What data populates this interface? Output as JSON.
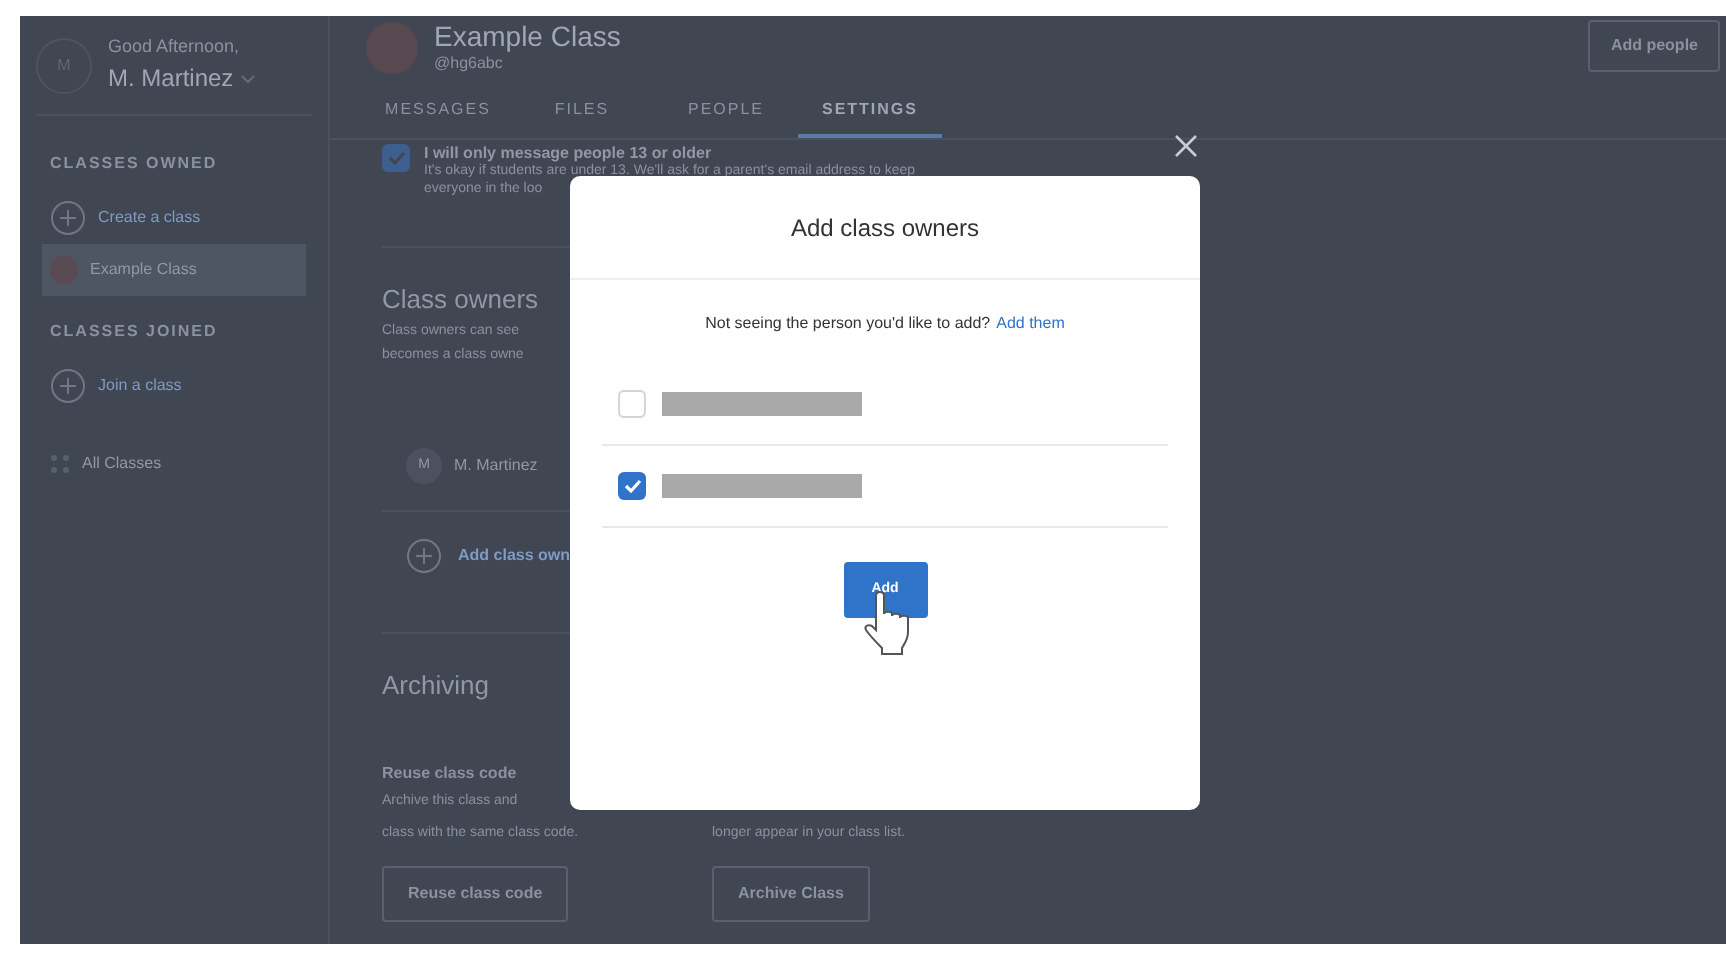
{
  "sidebar": {
    "avatar_initial": "M",
    "greeting": "Good Afternoon,",
    "user_name": "M. Martinez",
    "sections": [
      {
        "heading": "CLASSES OWNED",
        "items": [
          {
            "kind": "action",
            "label": "Create a class",
            "selected": false
          },
          {
            "kind": "class",
            "label": "Example Class",
            "selected": true
          }
        ]
      },
      {
        "heading": "CLASSES JOINED",
        "items": [
          {
            "kind": "action",
            "label": "Join a class",
            "selected": false
          }
        ]
      }
    ],
    "all_classes": "All Classes"
  },
  "header": {
    "class_name": "Example Class",
    "class_code": "@hg6abc",
    "tabs": [
      {
        "label": "MESSAGES",
        "selected": false
      },
      {
        "label": "FILES",
        "selected": false
      },
      {
        "label": "PEOPLE",
        "selected": false
      },
      {
        "label": "SETTINGS",
        "selected": true
      }
    ],
    "add_people_button": "Add people"
  },
  "settings": {
    "age_option": {
      "checked": true,
      "label": "I will only message people 13 or older",
      "description": [
        "It's okay if students are under 13. We'll ask for a parent's email address to keep",
        "everyone in the loo"
      ]
    },
    "class_owners": {
      "title": "Class owners",
      "description": [
        "Class owners can see",
        "becomes a class owne"
      ],
      "owners": [
        {
          "initial": "M",
          "name": "M. Martinez"
        }
      ],
      "add_owner": "Add class own"
    },
    "archiving": {
      "title": "Archiving",
      "reuse": {
        "title": "Reuse class code",
        "description": [
          "Archive this class and",
          "class with the same class code."
        ],
        "button": "Reuse class code"
      },
      "archive": {
        "description": [
          "longer appear in your class list."
        ],
        "button": "Archive Class"
      }
    }
  },
  "modal": {
    "title": "Add class owners",
    "prompt": "Not seeing the person you'd like to add?",
    "prompt_link": "Add them",
    "people": [
      {
        "checked": false
      },
      {
        "checked": true
      }
    ],
    "add_button": "Add"
  }
}
